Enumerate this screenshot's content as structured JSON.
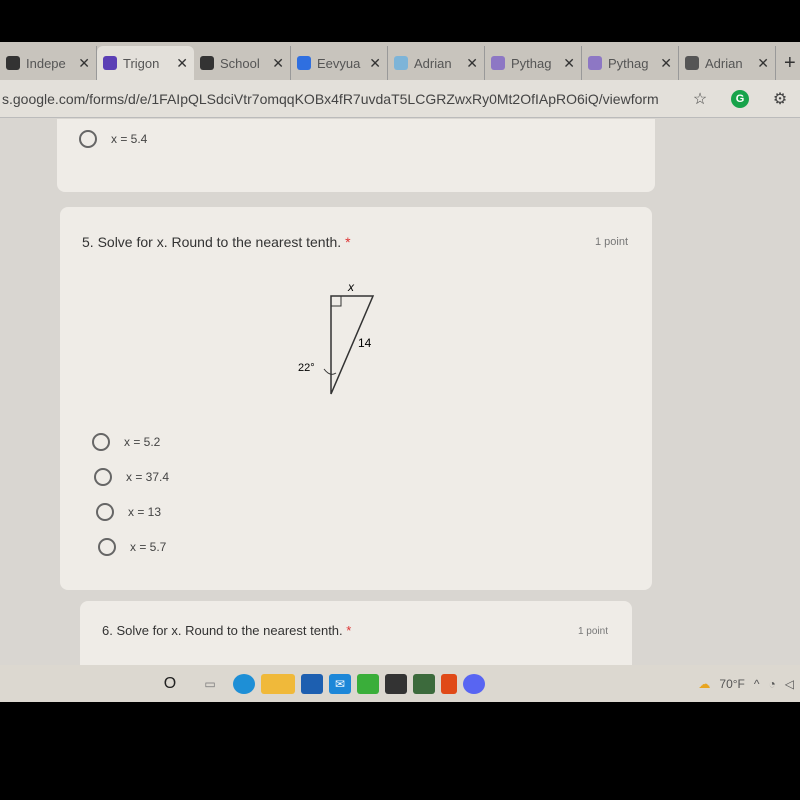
{
  "browser": {
    "tabs": [
      {
        "title": "Indepe",
        "icon": "schoology-icon",
        "color": "#333"
      },
      {
        "title": "Trigon",
        "icon": "forms-icon",
        "color": "#5b3fb5",
        "active": true
      },
      {
        "title": "School",
        "icon": "schoology-icon",
        "color": "#333"
      },
      {
        "title": "Eevyua",
        "icon": "docs-icon",
        "color": "#2f6fe0"
      },
      {
        "title": "Adrian",
        "icon": "bing-icon",
        "color": "#7db4d8"
      },
      {
        "title": "Pythag",
        "icon": "forms-icon",
        "color": "#8d77c4"
      },
      {
        "title": "Pythag",
        "icon": "forms-icon",
        "color": "#8d77c4"
      },
      {
        "title": "Adrian",
        "icon": "book-icon",
        "color": "#555"
      }
    ],
    "close_glyph": "✕",
    "new_tab": "+",
    "url": "s.google.com/forms/d/e/1FAIpQLSdciVtr7omqqKOBx4fR7uvdaT5LCGRZwxRy0Mt2OfIApRO6iQ/viewform",
    "grammarly": "G"
  },
  "form": {
    "prev_option": "x = 5.4",
    "q5": {
      "title": "5. Solve for x. Round to the nearest tenth.",
      "required": "*",
      "points": "1 point",
      "figure": {
        "top": "x",
        "hyp": "14",
        "angle": "22°"
      },
      "options": [
        "x = 5.2",
        "x = 37.4",
        "x = 13",
        "x = 5.7"
      ]
    },
    "q6": {
      "title": "6. Solve for x. Round to the nearest tenth.",
      "required": "*",
      "points": "1 point"
    }
  },
  "taskbar": {
    "weather": "70°F",
    "search_glyph": "O"
  }
}
